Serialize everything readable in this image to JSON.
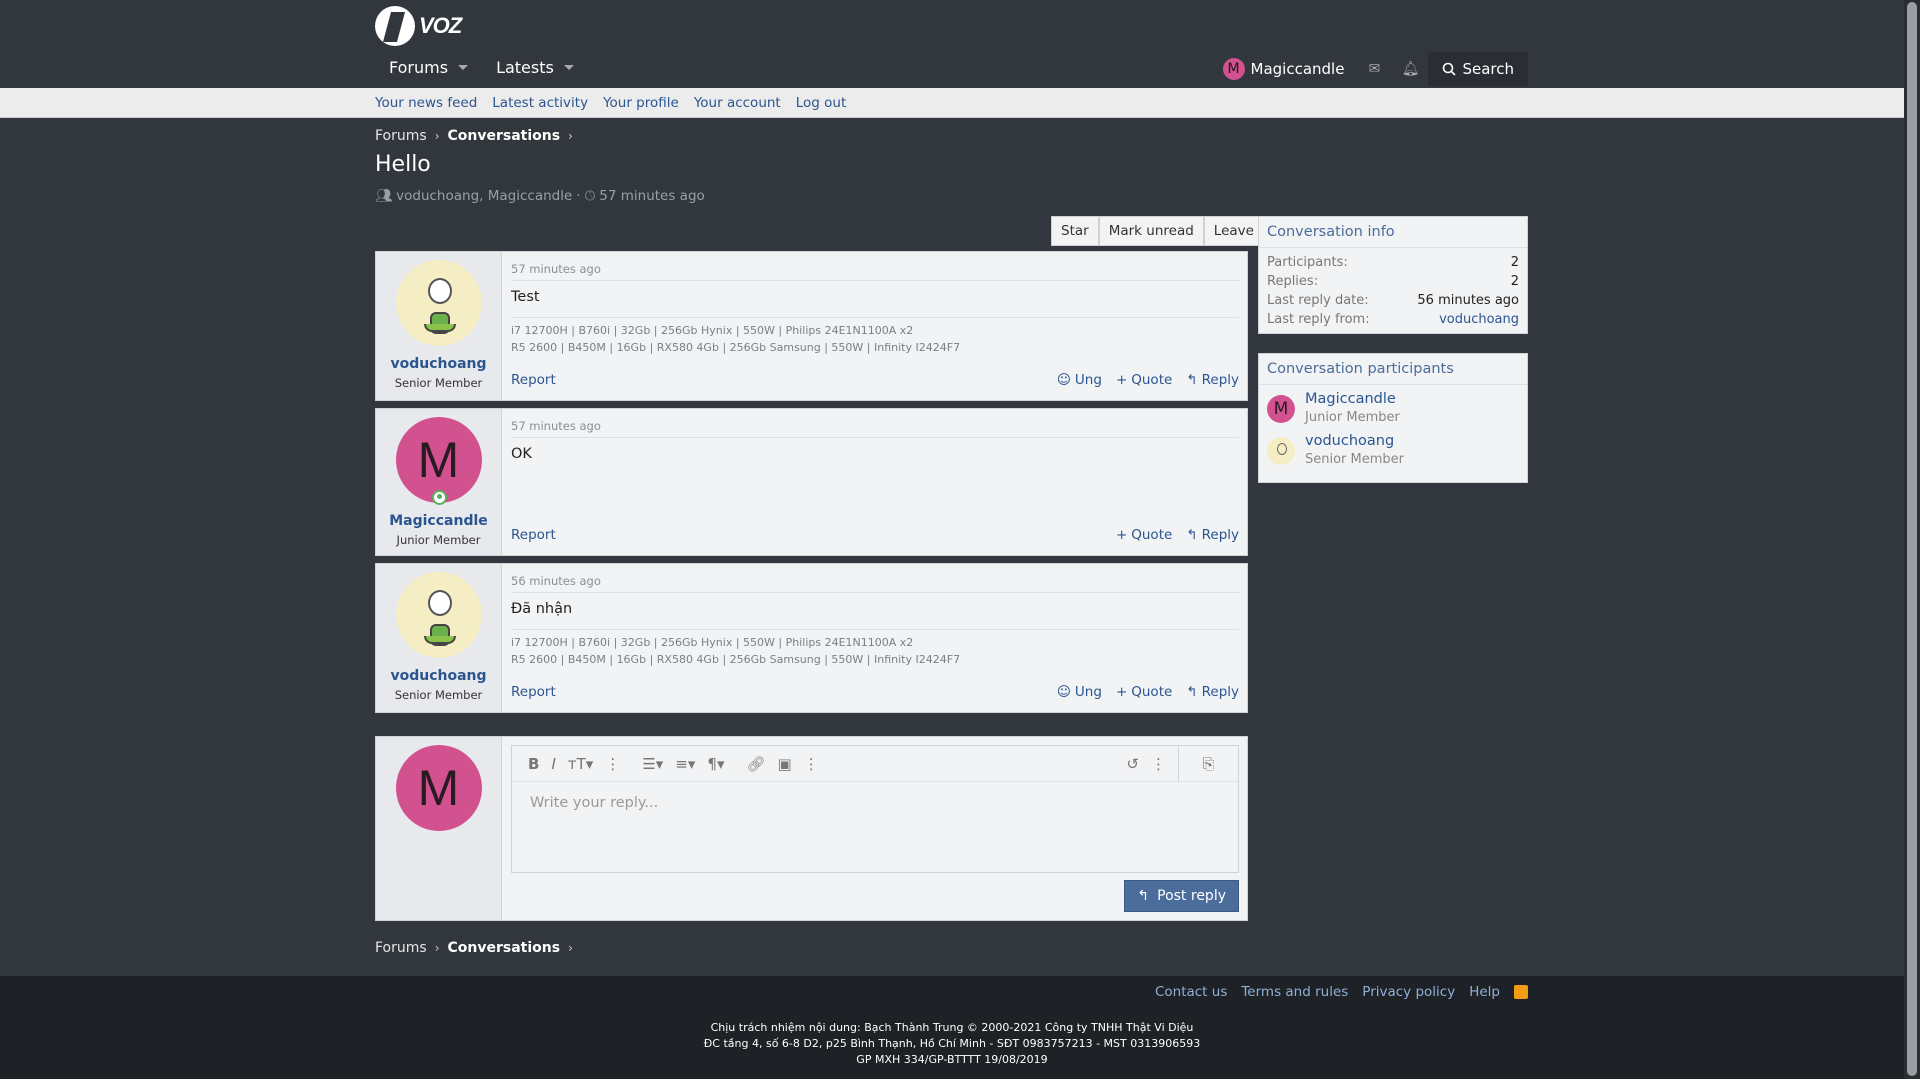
{
  "brand": {
    "logo_text": "VOZ"
  },
  "nav": {
    "forums": "Forums",
    "latests": "Latests"
  },
  "user": {
    "initial": "M",
    "name": "Magiccandle"
  },
  "search_label": "Search",
  "subnav": [
    "Your news feed",
    "Latest activity",
    "Your profile",
    "Your account",
    "Log out"
  ],
  "breadcrumb": {
    "forums": "Forums",
    "conversations": "Conversations"
  },
  "page": {
    "title": "Hello",
    "participants": "voduchoang, Magiccandle",
    "dot": "·",
    "time": "57 minutes ago"
  },
  "actions": {
    "star": "Star",
    "mark_unread": "Mark unread",
    "leave": "Leave"
  },
  "messages": [
    {
      "username": "voduchoang",
      "user_title": "Senior Member",
      "time": "57 minutes ago",
      "body": "Test",
      "sig1": "i7 12700H | B760i | 32Gb | 256Gb Hynix | 550W | Philips 24E1N1100A x2",
      "sig2": "R5 2600 | B450M | 16Gb | RX580 4Gb | 256Gb Samsung | 550W | Infinity I2424F7",
      "report": "Report",
      "ung": "Ung",
      "quote": "Quote",
      "reply": "Reply"
    },
    {
      "username": "Magiccandle",
      "user_title": "Junior Member",
      "initial": "M",
      "time": "57 minutes ago",
      "body": "OK",
      "report": "Report",
      "quote": "Quote",
      "reply": "Reply"
    },
    {
      "username": "voduchoang",
      "user_title": "Senior Member",
      "time": "56 minutes ago",
      "body": "Đã nhận",
      "sig1": "i7 12700H | B760i | 32Gb | 256Gb Hynix | 550W | Philips 24E1N1100A x2",
      "sig2": "R5 2600 | B450M | 16Gb | RX580 4Gb | 256Gb Samsung | 550W | Infinity I2424F7",
      "report": "Report",
      "ung": "Ung",
      "quote": "Quote",
      "reply": "Reply"
    }
  ],
  "editor": {
    "avatar_initial": "M",
    "placeholder": "Write your reply...",
    "post_label": "Post reply"
  },
  "conv_info": {
    "title": "Conversation info",
    "participants_label": "Participants:",
    "participants": "2",
    "replies_label": "Replies:",
    "replies": "2",
    "last_date_label": "Last reply date:",
    "last_date": "56 minutes ago",
    "last_from_label": "Last reply from:",
    "last_from": "voduchoang"
  },
  "conv_participants": {
    "title": "Conversation participants",
    "list": [
      {
        "name": "Magiccandle",
        "title": "Junior Member",
        "initial": "M"
      },
      {
        "name": "voduchoang",
        "title": "Senior Member"
      }
    ]
  },
  "footer": {
    "links": [
      "Contact us",
      "Terms and rules",
      "Privacy policy",
      "Help"
    ],
    "line1": "Chịu trách nhiệm nội dung: Bạch Thành Trung © 2000-2021 Công ty TNHH Thật Vi Diệu",
    "line2": "ĐC tầng 4, số 6-8 D2, p25 Bình Thạnh, Hồ Chí Minh - SĐT 0983757213 - MST 0313906593",
    "line3": "GP MXH 334/GP-BTTTT 19/08/2019"
  }
}
